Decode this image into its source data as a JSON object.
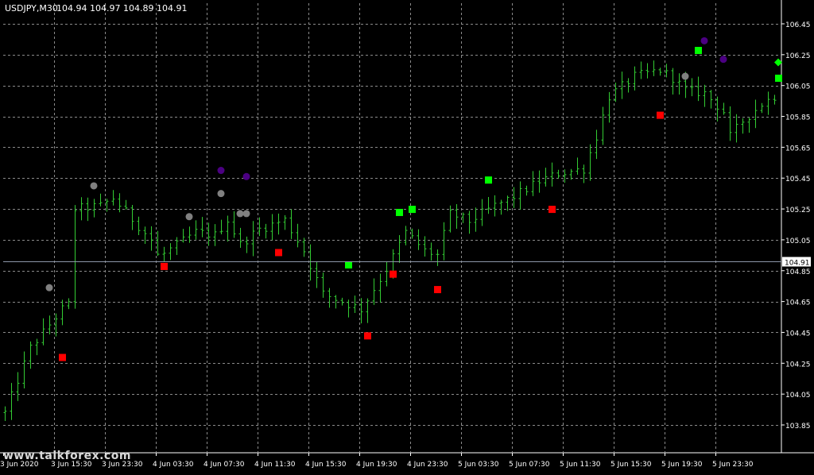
{
  "header": {
    "symbol": "USDJPY,M30",
    "quote": "104.94 104.97 104.89 104.91"
  },
  "watermark": "www.talkforex.com",
  "colors": {
    "background": "#000000",
    "grid": "#8a8a8a",
    "axis": "#ffffff",
    "bars": "#33cc33",
    "bid_line": "#8c96a8",
    "buy_marker": "#00ff00",
    "sell_marker": "#ff0000",
    "neutral_marker": "#808080",
    "purple_marker": "#4b0082"
  },
  "chart_data": {
    "type": "ohlc",
    "ylim": [
      103.76,
      106.56
    ],
    "y_ticks": [
      106.45,
      106.25,
      106.05,
      105.85,
      105.65,
      105.45,
      105.25,
      105.05,
      104.85,
      104.65,
      104.45,
      104.25,
      104.05,
      103.85
    ],
    "x_tick_labels": [
      "3 Jun 2020",
      "3 Jun 15:30",
      "3 Jun 23:30",
      "4 Jun 03:30",
      "4 Jun 07:30",
      "4 Jun 11:30",
      "4 Jun 15:30",
      "4 Jun 19:30",
      "4 Jun 23:30",
      "5 Jun 03:30",
      "5 Jun 07:30",
      "5 Jun 11:30",
      "5 Jun 15:30",
      "5 Jun 19:30",
      "5 Jun 23:30"
    ],
    "bid_price": "104.91",
    "bid_value": 104.91,
    "bar_count": 122,
    "path_anchors": [
      [
        0,
        103.93
      ],
      [
        4,
        104.35
      ],
      [
        9,
        104.6
      ],
      [
        10,
        104.63
      ],
      [
        11,
        105.25
      ],
      [
        15,
        105.27
      ],
      [
        17,
        105.32
      ],
      [
        19,
        105.23
      ],
      [
        23,
        105.05
      ],
      [
        24,
        104.95
      ],
      [
        25,
        104.96
      ],
      [
        30,
        105.1
      ],
      [
        33,
        105.08
      ],
      [
        35,
        105.18
      ],
      [
        37,
        105.02
      ],
      [
        40,
        105.12
      ],
      [
        44,
        105.18
      ],
      [
        47,
        104.98
      ],
      [
        50,
        104.7
      ],
      [
        56,
        104.6
      ],
      [
        60,
        104.86
      ],
      [
        63,
        105.1
      ],
      [
        66,
        104.98
      ],
      [
        68,
        104.95
      ],
      [
        70,
        105.22
      ],
      [
        73,
        105.17
      ],
      [
        77,
        105.27
      ],
      [
        80,
        105.33
      ],
      [
        84,
        105.43
      ],
      [
        87,
        105.48
      ],
      [
        91,
        105.51
      ],
      [
        93,
        105.72
      ],
      [
        95,
        105.98
      ],
      [
        99,
        106.11
      ],
      [
        103,
        106.15
      ],
      [
        105,
        106.1
      ],
      [
        107,
        106.02
      ],
      [
        110,
        106.0
      ],
      [
        113,
        105.88
      ],
      [
        114,
        105.72
      ],
      [
        116,
        105.82
      ],
      [
        119,
        105.93
      ],
      [
        121,
        105.98
      ]
    ],
    "markers": [
      {
        "kind": "sell",
        "shape": "square",
        "i": 9,
        "price": 104.29
      },
      {
        "kind": "sell",
        "shape": "square",
        "i": 25,
        "price": 104.88
      },
      {
        "kind": "sell",
        "shape": "square",
        "i": 43,
        "price": 104.97
      },
      {
        "kind": "sell",
        "shape": "square",
        "i": 57,
        "price": 104.43
      },
      {
        "kind": "sell",
        "shape": "square",
        "i": 61,
        "price": 104.83
      },
      {
        "kind": "sell",
        "shape": "square",
        "i": 68,
        "price": 104.73
      },
      {
        "kind": "sell",
        "shape": "square",
        "i": 86,
        "price": 105.25
      },
      {
        "kind": "sell",
        "shape": "square",
        "i": 103,
        "price": 105.86
      },
      {
        "kind": "buy",
        "shape": "square",
        "i": 54,
        "price": 104.89
      },
      {
        "kind": "buy",
        "shape": "square",
        "i": 62,
        "price": 105.23
      },
      {
        "kind": "buy",
        "shape": "square",
        "i": 64,
        "price": 105.25
      },
      {
        "kind": "buy",
        "shape": "square",
        "i": 76,
        "price": 105.44
      },
      {
        "kind": "buy",
        "shape": "square",
        "i": 109,
        "price": 106.28
      },
      {
        "kind": "buy",
        "shape": "square",
        "i": 122,
        "price": 106.1
      },
      {
        "kind": "buy",
        "shape": "diamond",
        "i": 122,
        "price": 106.2
      },
      {
        "kind": "neutral",
        "shape": "circle",
        "i": 7,
        "price": 104.74
      },
      {
        "kind": "neutral",
        "shape": "circle",
        "i": 14,
        "price": 105.4
      },
      {
        "kind": "neutral",
        "shape": "circle",
        "i": 29,
        "price": 105.2
      },
      {
        "kind": "neutral",
        "shape": "circle",
        "i": 34,
        "price": 105.35
      },
      {
        "kind": "neutral",
        "shape": "circle",
        "i": 37,
        "price": 105.22
      },
      {
        "kind": "neutral",
        "shape": "circle",
        "i": 38,
        "price": 105.22
      },
      {
        "kind": "neutral",
        "shape": "circle",
        "i": 107,
        "price": 106.11
      },
      {
        "kind": "purple",
        "shape": "circle",
        "i": 34,
        "price": 105.5
      },
      {
        "kind": "purple",
        "shape": "circle",
        "i": 38,
        "price": 105.46
      },
      {
        "kind": "purple",
        "shape": "circle",
        "i": 110,
        "price": 106.34
      },
      {
        "kind": "purple",
        "shape": "circle",
        "i": 113,
        "price": 106.22
      }
    ]
  }
}
